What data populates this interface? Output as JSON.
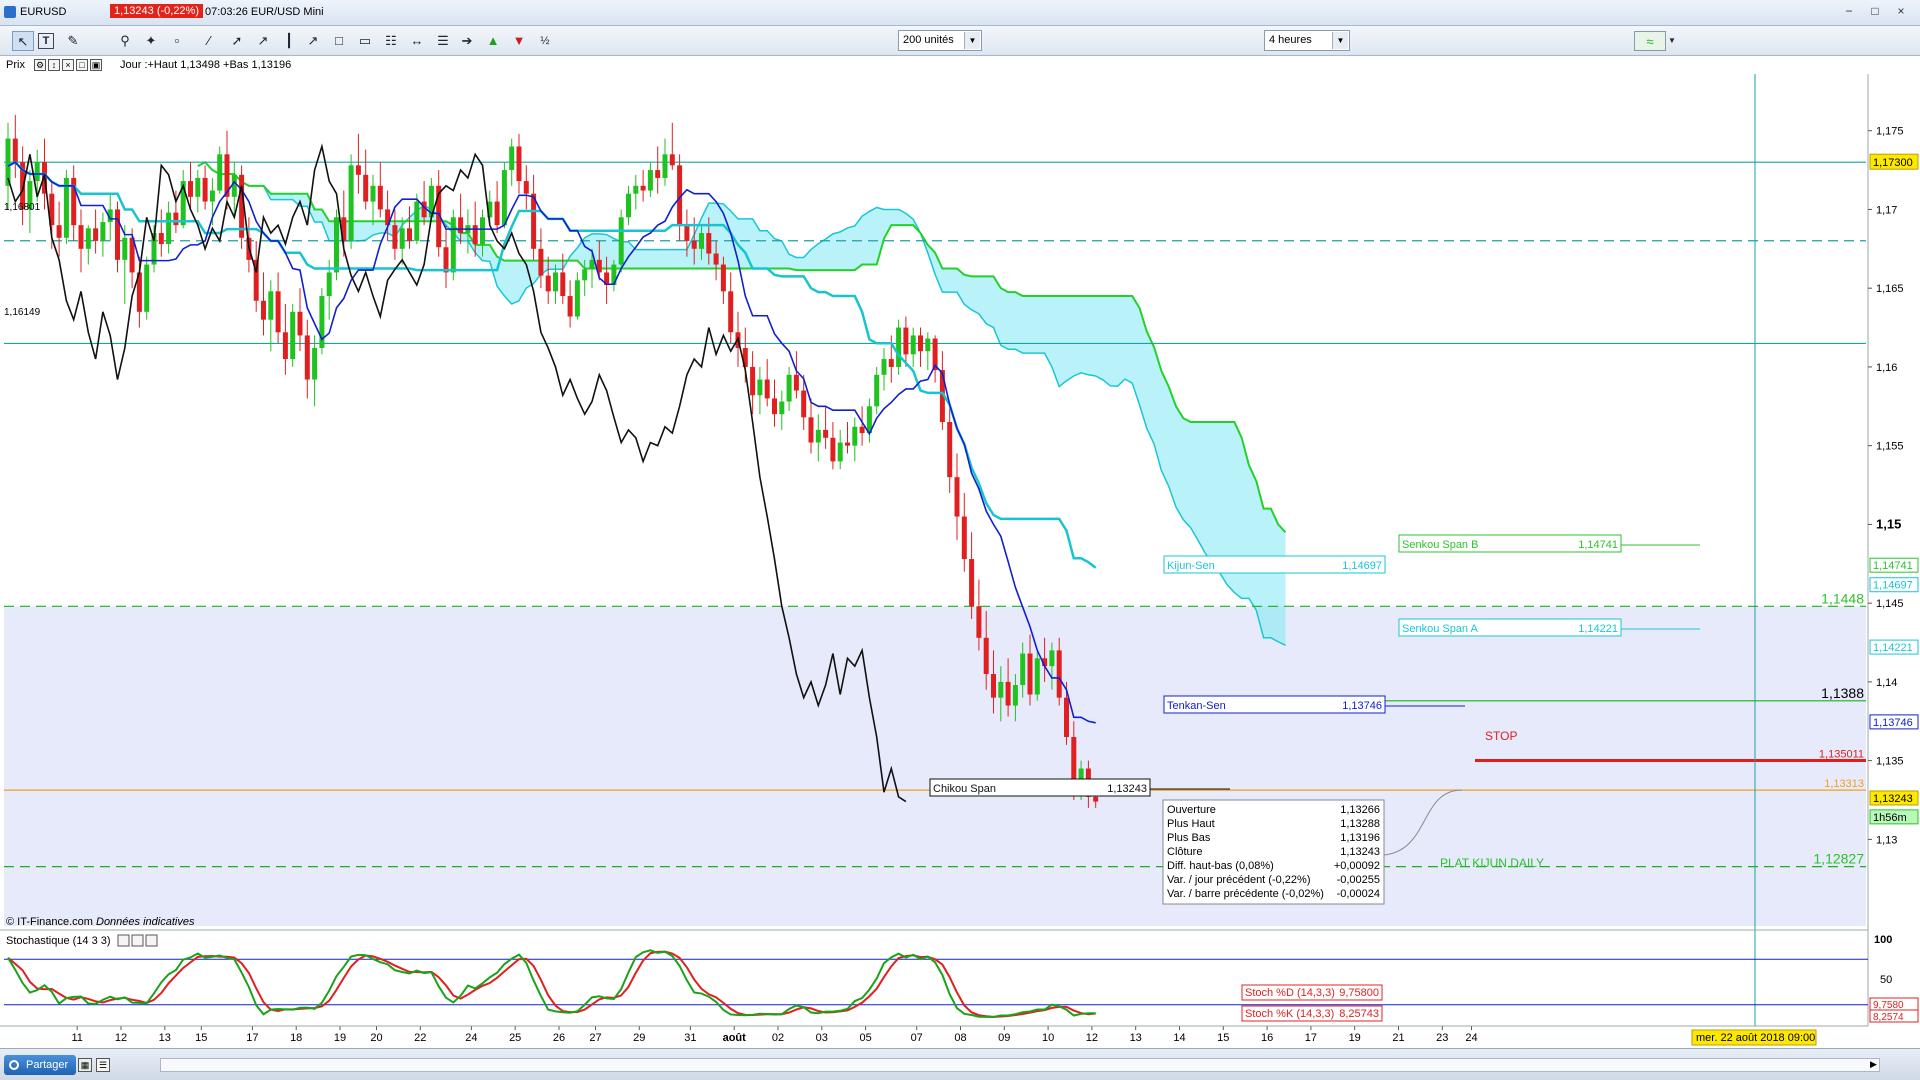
{
  "window": {
    "symbol": "EURUSD",
    "price_badge": "1,13243 (-0,22%)",
    "info": "07:03:26 EUR/USD Mini",
    "controls": [
      "−",
      "□",
      "×"
    ]
  },
  "toolbar": {
    "units": "200 unités",
    "period": "4 heures",
    "icons": [
      "cursor-icon",
      "text-icon",
      "ruler-icon",
      "search-icon",
      "magnet-icon",
      "eraser-icon",
      "line-icon",
      "vertical-line-icon",
      "trend-icon",
      "rect-icon",
      "channel-icon",
      "fibo-icon",
      "arrow-h-icon",
      "pitchfork-icon",
      "arrow-right-icon",
      "arrow-up-icon",
      "arrow-down-icon",
      "percent-icon"
    ]
  },
  "pricebar": {
    "label": "Prix",
    "jour": "Jour :+Haut 1,13498 +Bas 1,13196"
  },
  "chart_data": {
    "type": "candlestick",
    "instrument": "EURUSD",
    "timeframe": "4 heures",
    "ylim": [
      1.1245,
      1.1786
    ],
    "y_ticks": [
      "1,175",
      "1,17",
      "1,165",
      "1,16",
      "1,155",
      "1,15",
      "1,145",
      "1,14",
      "1,135",
      "1,13"
    ],
    "y_tick_values": [
      1.175,
      1.17,
      1.165,
      1.16,
      1.155,
      1.15,
      1.145,
      1.14,
      1.135,
      1.13
    ],
    "x_ticks": [
      "11",
      "12",
      "13",
      "15",
      "17",
      "18",
      "19",
      "20",
      "22",
      "24",
      "25",
      "26",
      "27",
      "29",
      "31",
      "août",
      "02",
      "03",
      "05",
      "07",
      "08",
      "09",
      "10",
      "12",
      "13",
      "14",
      "15",
      "16",
      "17",
      "19",
      "21",
      "23",
      "24"
    ],
    "x_tick_idx": [
      4,
      10,
      16,
      21,
      28,
      34,
      40,
      45,
      51,
      58,
      64,
      70,
      75,
      81,
      88,
      94,
      100,
      106,
      112,
      119,
      125,
      131,
      137,
      143,
      149,
      155,
      161,
      167,
      173,
      179,
      185,
      191,
      195
    ],
    "candles": [
      [
        1.1715,
        1.1755,
        1.17,
        1.1745
      ],
      [
        1.1745,
        1.176,
        1.172,
        1.173
      ],
      [
        1.173,
        1.174,
        1.169,
        1.17
      ],
      [
        1.17,
        1.1725,
        1.1685,
        1.1718
      ],
      [
        1.1718,
        1.1738,
        1.1705,
        1.173
      ],
      [
        1.173,
        1.1745,
        1.17,
        1.171
      ],
      [
        1.171,
        1.1718,
        1.1675,
        1.169
      ],
      [
        1.169,
        1.1705,
        1.167,
        1.1682
      ],
      [
        1.1682,
        1.1725,
        1.1678,
        1.172
      ],
      [
        1.172,
        1.1728,
        1.168,
        1.169
      ],
      [
        1.169,
        1.17,
        1.166,
        1.1675
      ],
      [
        1.1675,
        1.169,
        1.1665,
        1.1688
      ],
      [
        1.1688,
        1.17,
        1.1672,
        1.168
      ],
      [
        1.168,
        1.1698,
        1.167,
        1.1692
      ],
      [
        1.1692,
        1.171,
        1.168,
        1.17
      ],
      [
        1.17,
        1.1705,
        1.166,
        1.1668
      ],
      [
        1.1668,
        1.169,
        1.164,
        1.1682
      ],
      [
        1.1682,
        1.1688,
        1.165,
        1.166
      ],
      [
        1.166,
        1.167,
        1.1625,
        1.1635
      ],
      [
        1.1635,
        1.167,
        1.163,
        1.1665
      ],
      [
        1.1665,
        1.169,
        1.166,
        1.1685
      ],
      [
        1.1685,
        1.17,
        1.167,
        1.1678
      ],
      [
        1.1678,
        1.1705,
        1.1672,
        1.1698
      ],
      [
        1.1698,
        1.1712,
        1.1685,
        1.169
      ],
      [
        1.169,
        1.1725,
        1.1688,
        1.1718
      ],
      [
        1.1718,
        1.173,
        1.17,
        1.1708
      ],
      [
        1.1708,
        1.1725,
        1.1698,
        1.172
      ],
      [
        1.172,
        1.1728,
        1.17,
        1.1705
      ],
      [
        1.1705,
        1.172,
        1.169,
        1.1712
      ],
      [
        1.1712,
        1.174,
        1.171,
        1.1735
      ],
      [
        1.1735,
        1.175,
        1.17,
        1.1708
      ],
      [
        1.1708,
        1.173,
        1.1695,
        1.1722
      ],
      [
        1.1722,
        1.1728,
        1.1675,
        1.1682
      ],
      [
        1.1682,
        1.1695,
        1.166,
        1.1668
      ],
      [
        1.1668,
        1.168,
        1.1635,
        1.1642
      ],
      [
        1.1642,
        1.166,
        1.162,
        1.163
      ],
      [
        1.163,
        1.1655,
        1.161,
        1.1648
      ],
      [
        1.1648,
        1.166,
        1.1615,
        1.1622
      ],
      [
        1.1622,
        1.164,
        1.1595,
        1.1605
      ],
      [
        1.1605,
        1.164,
        1.16,
        1.1635
      ],
      [
        1.1635,
        1.165,
        1.161,
        1.162
      ],
      [
        1.162,
        1.163,
        1.158,
        1.1592
      ],
      [
        1.1592,
        1.162,
        1.1575,
        1.1612
      ],
      [
        1.1612,
        1.165,
        1.1608,
        1.1645
      ],
      [
        1.1645,
        1.1668,
        1.163,
        1.166
      ],
      [
        1.166,
        1.17,
        1.1655,
        1.1695
      ],
      [
        1.1695,
        1.1712,
        1.167,
        1.168
      ],
      [
        1.168,
        1.1735,
        1.1675,
        1.1728
      ],
      [
        1.1728,
        1.1748,
        1.171,
        1.1722
      ],
      [
        1.1722,
        1.1738,
        1.17,
        1.1705
      ],
      [
        1.1705,
        1.1722,
        1.169,
        1.1715
      ],
      [
        1.1715,
        1.173,
        1.1695,
        1.17
      ],
      [
        1.17,
        1.1712,
        1.168,
        1.169
      ],
      [
        1.169,
        1.17,
        1.1668,
        1.1675
      ],
      [
        1.1675,
        1.1695,
        1.1665,
        1.1688
      ],
      [
        1.1688,
        1.1702,
        1.1675,
        1.168
      ],
      [
        1.168,
        1.171,
        1.1678,
        1.1705
      ],
      [
        1.1705,
        1.1718,
        1.169,
        1.1695
      ],
      [
        1.1695,
        1.172,
        1.1692,
        1.1715
      ],
      [
        1.1715,
        1.1725,
        1.167,
        1.1676
      ],
      [
        1.1676,
        1.169,
        1.165,
        1.166
      ],
      [
        1.166,
        1.17,
        1.1655,
        1.1695
      ],
      [
        1.1695,
        1.171,
        1.1678,
        1.1685
      ],
      [
        1.1685,
        1.17,
        1.1672,
        1.169
      ],
      [
        1.169,
        1.1705,
        1.167,
        1.1678
      ],
      [
        1.1678,
        1.17,
        1.167,
        1.1695
      ],
      [
        1.1695,
        1.1712,
        1.169,
        1.1705
      ],
      [
        1.1705,
        1.1718,
        1.1685,
        1.169
      ],
      [
        1.169,
        1.173,
        1.1688,
        1.1725
      ],
      [
        1.1725,
        1.1745,
        1.1715,
        1.174
      ],
      [
        1.174,
        1.1748,
        1.171,
        1.1718
      ],
      [
        1.1718,
        1.1728,
        1.17,
        1.171
      ],
      [
        1.171,
        1.1722,
        1.1668,
        1.1675
      ],
      [
        1.1675,
        1.1688,
        1.165,
        1.1658
      ],
      [
        1.1658,
        1.167,
        1.164,
        1.1648
      ],
      [
        1.1648,
        1.1665,
        1.164,
        1.166
      ],
      [
        1.166,
        1.1672,
        1.164,
        1.1645
      ],
      [
        1.1645,
        1.1655,
        1.1625,
        1.1632
      ],
      [
        1.1632,
        1.166,
        1.163,
        1.1655
      ],
      [
        1.1655,
        1.1668,
        1.1645,
        1.1662
      ],
      [
        1.1662,
        1.1675,
        1.165,
        1.1668
      ],
      [
        1.1668,
        1.168,
        1.1655,
        1.166
      ],
      [
        1.166,
        1.167,
        1.164,
        1.1652
      ],
      [
        1.1652,
        1.1668,
        1.1648,
        1.1665
      ],
      [
        1.1665,
        1.17,
        1.166,
        1.1695
      ],
      [
        1.1695,
        1.1715,
        1.169,
        1.171
      ],
      [
        1.171,
        1.1722,
        1.17,
        1.1715
      ],
      [
        1.1715,
        1.1725,
        1.1705,
        1.1712
      ],
      [
        1.1712,
        1.173,
        1.1708,
        1.1725
      ],
      [
        1.1725,
        1.174,
        1.171,
        1.172
      ],
      [
        1.172,
        1.1745,
        1.1715,
        1.1735
      ],
      [
        1.1735,
        1.1755,
        1.1725,
        1.1728
      ],
      [
        1.1728,
        1.1735,
        1.168,
        1.169
      ],
      [
        1.169,
        1.17,
        1.167,
        1.168
      ],
      [
        1.168,
        1.1695,
        1.1665,
        1.1675
      ],
      [
        1.1675,
        1.169,
        1.1668,
        1.1685
      ],
      [
        1.1685,
        1.1695,
        1.1665,
        1.1672
      ],
      [
        1.1672,
        1.168,
        1.1655,
        1.1665
      ],
      [
        1.1665,
        1.167,
        1.164,
        1.1648
      ],
      [
        1.1648,
        1.166,
        1.1615,
        1.1622
      ],
      [
        1.1622,
        1.1635,
        1.16,
        1.1612
      ],
      [
        1.1612,
        1.1625,
        1.159,
        1.16
      ],
      [
        1.16,
        1.161,
        1.157,
        1.1582
      ],
      [
        1.1582,
        1.16,
        1.157,
        1.1592
      ],
      [
        1.1592,
        1.1605,
        1.1575,
        1.158
      ],
      [
        1.158,
        1.1592,
        1.1562,
        1.157
      ],
      [
        1.157,
        1.1585,
        1.156,
        1.1578
      ],
      [
        1.1578,
        1.16,
        1.1572,
        1.1595
      ],
      [
        1.1595,
        1.161,
        1.158,
        1.1585
      ],
      [
        1.1585,
        1.1595,
        1.156,
        1.1568
      ],
      [
        1.1568,
        1.158,
        1.1545,
        1.1552
      ],
      [
        1.1552,
        1.157,
        1.154,
        1.156
      ],
      [
        1.156,
        1.1575,
        1.1548,
        1.1555
      ],
      [
        1.1555,
        1.1565,
        1.1535,
        1.154
      ],
      [
        1.154,
        1.156,
        1.1535,
        1.1552
      ],
      [
        1.1552,
        1.1565,
        1.1545,
        1.155
      ],
      [
        1.155,
        1.1568,
        1.154,
        1.1562
      ],
      [
        1.1562,
        1.1575,
        1.155,
        1.1558
      ],
      [
        1.1558,
        1.158,
        1.1552,
        1.1575
      ],
      [
        1.1575,
        1.16,
        1.157,
        1.1595
      ],
      [
        1.1595,
        1.1612,
        1.1585,
        1.1605
      ],
      [
        1.1605,
        1.162,
        1.159,
        1.16
      ],
      [
        1.16,
        1.163,
        1.1595,
        1.1625
      ],
      [
        1.1625,
        1.1632,
        1.16,
        1.1608
      ],
      [
        1.1608,
        1.1625,
        1.16,
        1.162
      ],
      [
        1.162,
        1.1625,
        1.16,
        1.161
      ],
      [
        1.161,
        1.1622,
        1.1598,
        1.1618
      ],
      [
        1.1618,
        1.162,
        1.159,
        1.1598
      ],
      [
        1.1598,
        1.161,
        1.156,
        1.1565
      ],
      [
        1.1565,
        1.1578,
        1.152,
        1.153
      ],
      [
        1.153,
        1.1545,
        1.149,
        1.1505
      ],
      [
        1.1505,
        1.152,
        1.147,
        1.1478
      ],
      [
        1.1478,
        1.1495,
        1.144,
        1.1448
      ],
      [
        1.1448,
        1.1465,
        1.142,
        1.1428
      ],
      [
        1.1428,
        1.1445,
        1.1395,
        1.1405
      ],
      [
        1.1405,
        1.142,
        1.138,
        1.139
      ],
      [
        1.139,
        1.141,
        1.1375,
        1.14
      ],
      [
        1.14,
        1.1415,
        1.1378,
        1.1385
      ],
      [
        1.1385,
        1.1405,
        1.1375,
        1.1398
      ],
      [
        1.1398,
        1.1425,
        1.139,
        1.1418
      ],
      [
        1.1418,
        1.143,
        1.1385,
        1.1392
      ],
      [
        1.1392,
        1.142,
        1.1388,
        1.1415
      ],
      [
        1.1415,
        1.1428,
        1.14,
        1.141
      ],
      [
        1.141,
        1.1425,
        1.1395,
        1.142
      ],
      [
        1.142,
        1.1428,
        1.1385,
        1.139
      ],
      [
        1.139,
        1.14,
        1.136,
        1.1365
      ],
      [
        1.1365,
        1.1375,
        1.1325,
        1.133
      ],
      [
        1.133,
        1.135,
        1.1325,
        1.1345
      ],
      [
        1.1345,
        1.135,
        1.132,
        1.1327
      ],
      [
        1.1327,
        1.1335,
        1.132,
        1.1324
      ]
    ],
    "tenkan_sen": "1,13746",
    "kijun_sen": "1,14697",
    "senkou_span_a": "1,14221",
    "senkou_span_b": "1,14741",
    "chikou_span": "1,13243",
    "levels": [
      {
        "label": "1,17300",
        "value": 1.173,
        "color": "#1aa3a3"
      },
      {
        "label": "1,16801",
        "value": 1.16801,
        "color": "#1aa3a3",
        "dashed": true
      },
      {
        "label": "1,16149",
        "value": 1.16149,
        "color": "#1aa3a3"
      },
      {
        "label": "1,1448",
        "value": 1.1448,
        "color": "#19b319",
        "dashed": true
      },
      {
        "label": "1,1388",
        "value": 1.1388,
        "color": "#19b319"
      },
      {
        "label": "1,135011",
        "value": 1.135011,
        "color": "#e21b1b"
      },
      {
        "label": "1,13313",
        "value": 1.13313,
        "color": "#f0a020"
      },
      {
        "label": "1,12827",
        "value": 1.12827,
        "color": "#19b319",
        "dashed": true
      }
    ],
    "annotations": {
      "stop": "STOP",
      "plat_kijun": "PLAT KIJUN DAILY",
      "copyright": "© IT-Finance.com",
      "copyright_note": "Données indicatives",
      "date_label": "mer. 22 août 2018 09:00",
      "countdown": "1h56m",
      "price_tag": "1,13243",
      "price_tag_sub": "1,13243"
    },
    "left_labels": [
      "1,16801",
      "1,16149"
    ],
    "ohlc_box": [
      [
        "Ouverture",
        "1,13266"
      ],
      [
        "Plus Haut",
        "1,13288"
      ],
      [
        "Plus Bas",
        "1,13196"
      ],
      [
        "Clôture",
        "1,13243"
      ],
      [
        "Diff. haut-bas (0,08%)",
        "+0,00092"
      ],
      [
        "Var. / jour précédent (-0,22%)",
        "-0,00255"
      ],
      [
        "Var. / barre précédente (-0,02%)",
        "-0,00024"
      ]
    ],
    "stochastic": {
      "title": "Stochastique (14 3 3)",
      "d_label": "Stoch %D (14,3,3)",
      "d_value": "9,75800",
      "k_label": "Stoch %K (14,3,3)",
      "k_value": "8,25743",
      "axis": [
        "100",
        "50"
      ],
      "axis_right_d": "9,7580",
      "axis_right_k": "8,2574"
    }
  },
  "footer": {
    "share": "Partager"
  }
}
